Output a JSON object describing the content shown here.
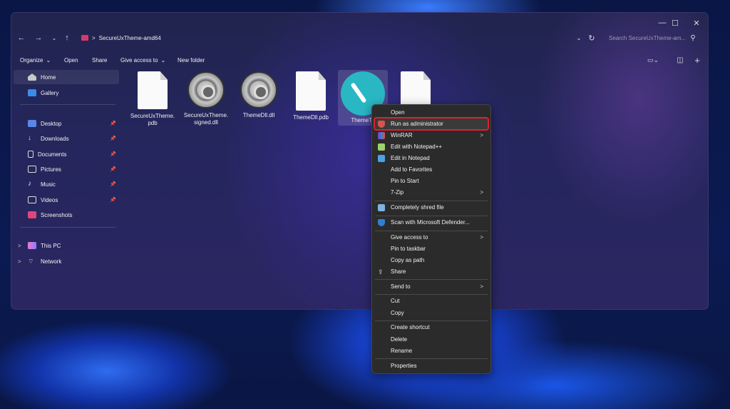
{
  "window": {
    "controls": {
      "minimize": "—",
      "maximize": "☐",
      "close": "✕"
    },
    "breadcrumb": {
      "separator": ">",
      "folder": "SecureUxTheme-amd64"
    },
    "search": {
      "placeholder": "Search SecureUxTheme-am..."
    }
  },
  "toolbar": {
    "organize": "Organize",
    "open": "Open",
    "share": "Share",
    "give_access": "Give access to",
    "new_folder": "New folder"
  },
  "sidebar": {
    "items": [
      {
        "label": "Home",
        "color": "#c9c9c9"
      },
      {
        "label": "Gallery",
        "color": "#3b8be8"
      },
      {
        "label": "Desktop",
        "color": "#5a86e8"
      },
      {
        "label": "Downloads",
        "color": "#cfcfcf"
      },
      {
        "label": "Documents",
        "color": "#cfcfcf"
      },
      {
        "label": "Pictures",
        "color": "#cfcfcf"
      },
      {
        "label": "Music",
        "color": "#e0e0e0"
      },
      {
        "label": "Videos",
        "color": "#cfcfcf"
      },
      {
        "label": "Screenshots",
        "color": "#e0457a"
      },
      {
        "label": "This PC",
        "color": "#e77bd0"
      },
      {
        "label": "Network",
        "color": "#cfcfcf"
      }
    ]
  },
  "files": [
    {
      "name": "SecureUxTheme.\npdb",
      "icon": "document-icon"
    },
    {
      "name": "SecureUxTheme.\nsigned.dll",
      "icon": "gear-icon"
    },
    {
      "name": "ThemeDll.dll",
      "icon": "gear-icon"
    },
    {
      "name": "ThemeDll.pdb",
      "icon": "document-icon"
    },
    {
      "name": "ThemeTo",
      "icon": "brush-app-icon"
    },
    {
      "name": "",
      "icon": "document-icon"
    }
  ],
  "context_menu": {
    "items": [
      {
        "label": "Open"
      },
      {
        "label": "Run as administrator"
      },
      {
        "label": "WinRAR"
      },
      {
        "label": "Edit with Notepad++"
      },
      {
        "label": "Edit in Notepad"
      },
      {
        "label": "Add to Favorites"
      },
      {
        "label": "Pin to Start"
      },
      {
        "label": "7-Zip"
      },
      {
        "label": "Completely shred file"
      },
      {
        "label": "Scan with Microsoft Defender..."
      },
      {
        "label": "Give access to"
      },
      {
        "label": "Pin to taskbar"
      },
      {
        "label": "Copy as path"
      },
      {
        "label": "Share"
      },
      {
        "label": "Send to"
      },
      {
        "label": "Cut"
      },
      {
        "label": "Copy"
      },
      {
        "label": "Create shortcut"
      },
      {
        "label": "Delete"
      },
      {
        "label": "Rename"
      },
      {
        "label": "Properties"
      }
    ],
    "highlight_color": "#e0202a"
  }
}
